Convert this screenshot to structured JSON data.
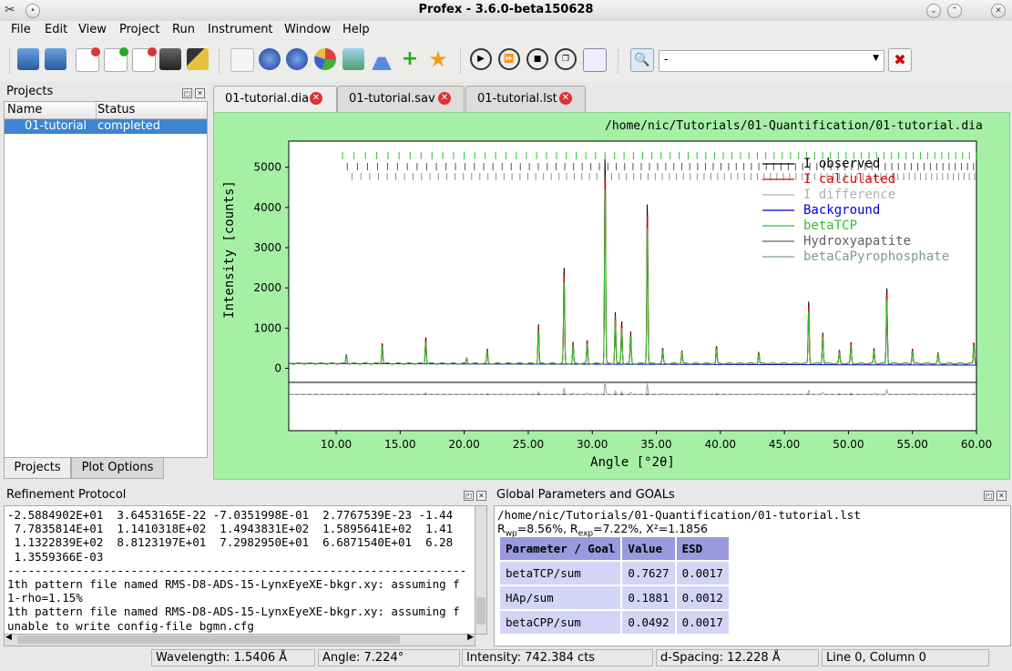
{
  "window": {
    "title": "Profex - 3.6.0-beta150628"
  },
  "menu": [
    "File",
    "Edit",
    "View",
    "Project",
    "Run",
    "Instrument",
    "Window",
    "Help"
  ],
  "toolbar": {
    "combo_value": "-"
  },
  "projects": {
    "title": "Projects",
    "columns": [
      "Name",
      "Status"
    ],
    "row": {
      "name": "01-tutorial",
      "status": "completed"
    },
    "bottom_tabs": [
      "Projects",
      "Plot Options"
    ]
  },
  "tabs": [
    "01-tutorial.dia",
    "01-tutorial.sav",
    "01-tutorial.lst"
  ],
  "plot": {
    "path": "/home/nic/Tutorials/01-Quantification/01-tutorial.dia",
    "ylabel": "Intensity [counts]",
    "xlabel": "Angle [°2θ]",
    "yticks": [
      "0",
      "1000",
      "2000",
      "3000",
      "4000",
      "5000"
    ],
    "xticks": [
      "10.00",
      "15.00",
      "20.00",
      "25.00",
      "30.00",
      "35.00",
      "40.00",
      "45.00",
      "50.00",
      "55.00",
      "60.00"
    ],
    "legend": [
      {
        "label": "I observed",
        "color": "#000000"
      },
      {
        "label": "I calculated",
        "color": "#e00000"
      },
      {
        "label": "I difference",
        "color": "#b0b0b0"
      },
      {
        "label": "Background",
        "color": "#0000e0"
      },
      {
        "label": "betaTCP",
        "color": "#2ec02e"
      },
      {
        "label": "Hydroxyapatite",
        "color": "#606060"
      },
      {
        "label": "betaCaPyrophosphate",
        "color": "#7a9a9a"
      }
    ]
  },
  "chart_data": {
    "type": "line",
    "xlabel": "Angle [°2θ]",
    "ylabel": "Intensity [counts]",
    "xlim": [
      6.3,
      60.0
    ],
    "ylim": [
      -1550,
      5650
    ],
    "background": 120,
    "peaks": [
      {
        "x": 10.8,
        "y": 350
      },
      {
        "x": 13.6,
        "y": 650
      },
      {
        "x": 17.0,
        "y": 800
      },
      {
        "x": 20.2,
        "y": 250
      },
      {
        "x": 21.8,
        "y": 480
      },
      {
        "x": 25.8,
        "y": 1100
      },
      {
        "x": 27.8,
        "y": 2550
      },
      {
        "x": 28.5,
        "y": 650
      },
      {
        "x": 29.6,
        "y": 700
      },
      {
        "x": 31.0,
        "y": 5350
      },
      {
        "x": 31.8,
        "y": 1400
      },
      {
        "x": 32.3,
        "y": 1200
      },
      {
        "x": 33.0,
        "y": 900
      },
      {
        "x": 34.3,
        "y": 4200
      },
      {
        "x": 35.5,
        "y": 500
      },
      {
        "x": 37.0,
        "y": 450
      },
      {
        "x": 39.7,
        "y": 550
      },
      {
        "x": 43.0,
        "y": 400
      },
      {
        "x": 46.9,
        "y": 1700
      },
      {
        "x": 48.0,
        "y": 900
      },
      {
        "x": 49.3,
        "y": 450
      },
      {
        "x": 50.2,
        "y": 650
      },
      {
        "x": 52.0,
        "y": 500
      },
      {
        "x": 53.0,
        "y": 2050
      },
      {
        "x": 55.0,
        "y": 500
      },
      {
        "x": 57.0,
        "y": 380
      },
      {
        "x": 59.8,
        "y": 650
      }
    ],
    "difference_offset": -650
  },
  "refinement": {
    "title": "Refinement Protocol",
    "lines": [
      "-2.5884902E+01  3.6453165E-22 -7.0351998E-01  2.7767539E-23 -1.44",
      " 7.7835814E+01  1.1410318E+02  1.4943831E+02  1.5895641E+02  1.41",
      " 1.1322839E+02  8.8123197E+01  7.2982950E+01  6.6871540E+01  6.28",
      " 1.3559366E-03",
      "-------------------------------------------------------------------",
      "1th pattern file named RMS-D8-ADS-15-LynxEyeXE-bkgr.xy: assuming f",
      "1-rho=1.15%",
      "1th pattern file named RMS-D8-ADS-15-LynxEyeXE-bkgr.xy: assuming f",
      "unable to write config-file bgmn.cfg"
    ]
  },
  "global": {
    "title": "Global Parameters and GOALs",
    "path": "/home/nic/Tutorials/01-Quantification/01-tutorial.lst",
    "rwp": "8.56%",
    "rexp": "7.22%",
    "chi2": "1.1856",
    "headers": [
      "Parameter / Goal",
      "Value",
      "ESD"
    ],
    "rows": [
      [
        "betaTCP/sum",
        "0.7627",
        "0.0017"
      ],
      [
        "HAp/sum",
        "0.1881",
        "0.0012"
      ],
      [
        "betaCPP/sum",
        "0.0492",
        "0.0017"
      ]
    ]
  },
  "status": {
    "wavelength": "Wavelength: 1.5406 Å",
    "angle": "Angle:    7.224°",
    "intensity": "Intensity:    742.384 cts",
    "dspacing": "d-Spacing: 12.228 Å",
    "line": "Line 0, Column 0"
  }
}
